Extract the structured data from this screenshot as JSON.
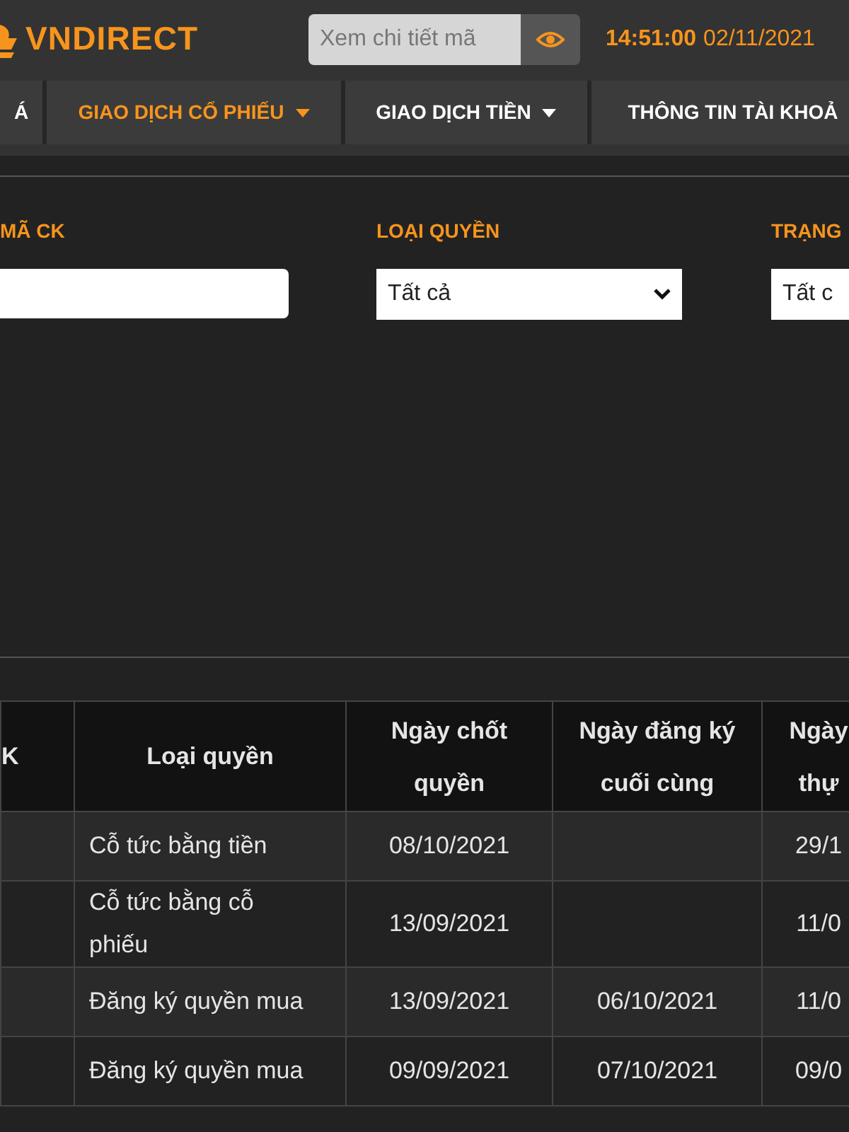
{
  "header": {
    "logo": "VNDIRECT",
    "search": {
      "placeholder": "Xem chi tiết mã"
    },
    "time": "14:51:00",
    "date": "02/11/2021"
  },
  "nav": [
    {
      "label": "Á",
      "selected": false,
      "dropdown": false
    },
    {
      "label": "GIAO DỊCH CỔ PHIẾU",
      "selected": true,
      "dropdown": true
    },
    {
      "label": "GIAO DỊCH TIỀN",
      "selected": false,
      "dropdown": true
    },
    {
      "label": "THÔNG TIN TÀI KHOẢ",
      "selected": false,
      "dropdown": false
    }
  ],
  "filters": [
    {
      "label": "MÃ CK",
      "kind": "text"
    },
    {
      "label": "LOẠI QUYỀN",
      "kind": "select",
      "value": "Tất cả"
    },
    {
      "label": "TRẠNG",
      "kind": "select",
      "value": "Tất c"
    }
  ],
  "table": {
    "columns": [
      "K",
      "Loại quyền",
      "Ngày chốt quyền",
      "Ngày đăng ký cuối cùng",
      "Ngày thự"
    ],
    "rows": [
      {
        "right_type": "Cỗ tức bằng tiền",
        "record_date": "08/10/2021",
        "column_5": "29/1"
      },
      {
        "right_type": "Cỗ tức bằng cỗ phiếu",
        "record_date": "13/09/2021",
        "column_5": "11/0"
      },
      {
        "right_type": "Đăng ký quyền mua",
        "record_date": "13/09/2021",
        "last_registration_date": "06/10/2021",
        "column_5": "11/0"
      },
      {
        "right_type": "Đăng ký quyền mua",
        "record_date": "09/09/2021",
        "last_registration_date": "07/10/2021",
        "column_5": "09/0"
      }
    ]
  }
}
